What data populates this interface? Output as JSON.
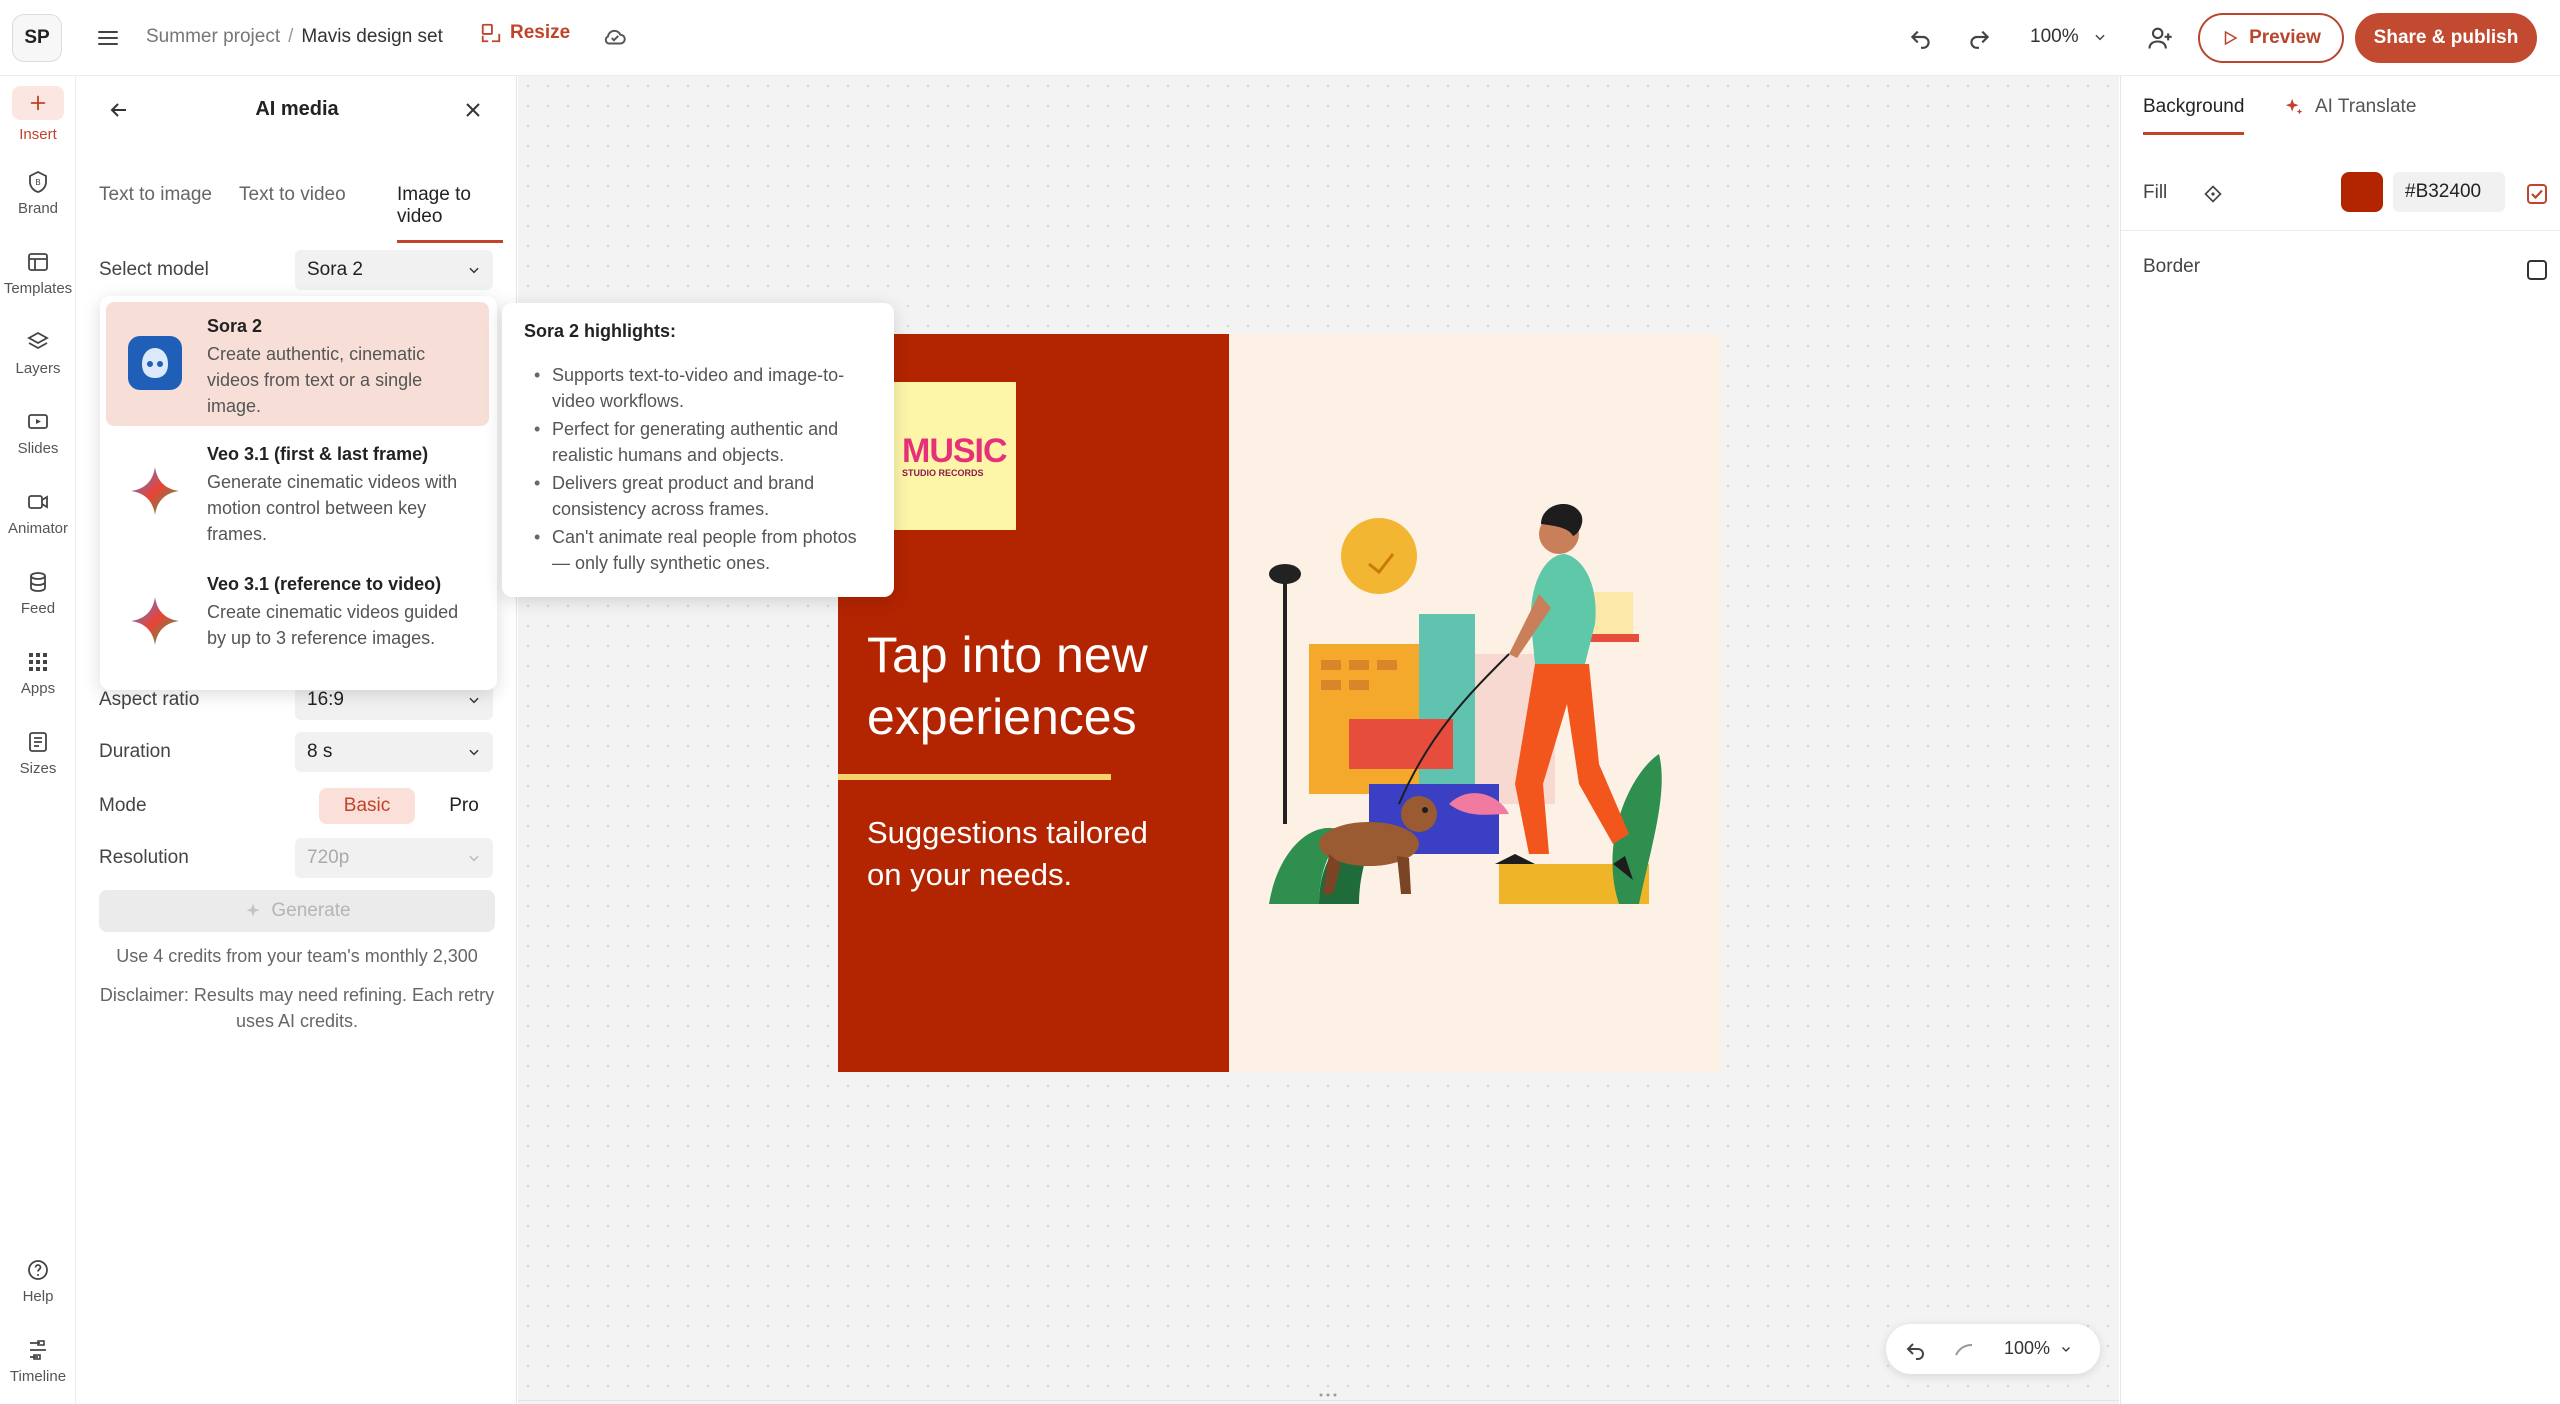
{
  "topbar": {
    "avatar": "SP",
    "breadcrumb": {
      "project": "Summer project",
      "separator": "/",
      "file": "Mavis design set"
    },
    "resize_label": "Resize",
    "zoom": "100%",
    "preview_label": "Preview",
    "publish_label": "Share & publish"
  },
  "rail": {
    "items": [
      {
        "label": "Insert",
        "icon": "plus-icon"
      },
      {
        "label": "Brand",
        "icon": "brand-icon"
      },
      {
        "label": "Templates",
        "icon": "templates-icon"
      },
      {
        "label": "Layers",
        "icon": "layers-icon"
      },
      {
        "label": "Slides",
        "icon": "slides-icon"
      },
      {
        "label": "Animator",
        "icon": "animator-icon"
      },
      {
        "label": "Feed",
        "icon": "feed-icon"
      },
      {
        "label": "Apps",
        "icon": "apps-icon"
      },
      {
        "label": "Sizes",
        "icon": "sizes-icon"
      }
    ],
    "help_label": "Help",
    "timeline_label": "Timeline"
  },
  "panel": {
    "title": "AI media",
    "tabs": [
      {
        "label": "Text to image"
      },
      {
        "label": "Text to video"
      },
      {
        "label": "Image to video"
      }
    ],
    "select_model_label": "Select model",
    "select_model_value": "Sora 2",
    "aspect_ratio_label": "Aspect ratio",
    "aspect_ratio_value": "16:9",
    "duration_label": "Duration",
    "duration_value": "8 s",
    "mode_label": "Mode",
    "mode_basic": "Basic",
    "mode_pro": "Pro",
    "resolution_label": "Resolution",
    "resolution_value": "720p",
    "generate_label": "Generate",
    "credits_text": "Use 4 credits from your team's monthly 2,300",
    "disclaimer_text": "Disclaimer: Results may need refining. Each retry uses AI credits."
  },
  "models": [
    {
      "name": "Sora 2",
      "description": "Create authentic, cinematic videos from text or a single image."
    },
    {
      "name": "Veo 3.1 (first & last frame)",
      "description": "Generate cinematic videos with motion control between key frames."
    },
    {
      "name": "Veo 3.1 (reference to video)",
      "description": "Create cinematic videos guided by up to 3 reference images."
    }
  ],
  "highlights": {
    "title": "Sora 2 highlights:",
    "items": [
      "Supports text-to-video and image-to-video workflows.",
      "Perfect for generating authentic and realistic humans and objects.",
      "Delivers great product and brand consistency across frames.",
      "Can't animate real people from photos — only fully synthetic ones."
    ]
  },
  "design": {
    "logo_main": "MUSIC",
    "logo_sub": "STUDIO RECORDS",
    "headline": "Tap into new experiences",
    "subhead": "Suggestions tailored on your needs.",
    "left_color": "#B32400",
    "right_color": "#FDF1E6"
  },
  "canvas_controls": {
    "zoom": "100%"
  },
  "rightpanel": {
    "tab_background": "Background",
    "tab_translate": "AI Translate",
    "fill_label": "Fill",
    "fill_hex": "#B32400",
    "border_label": "Border"
  },
  "colors": {
    "accent": "#C0432A",
    "fill": "#B32400"
  }
}
